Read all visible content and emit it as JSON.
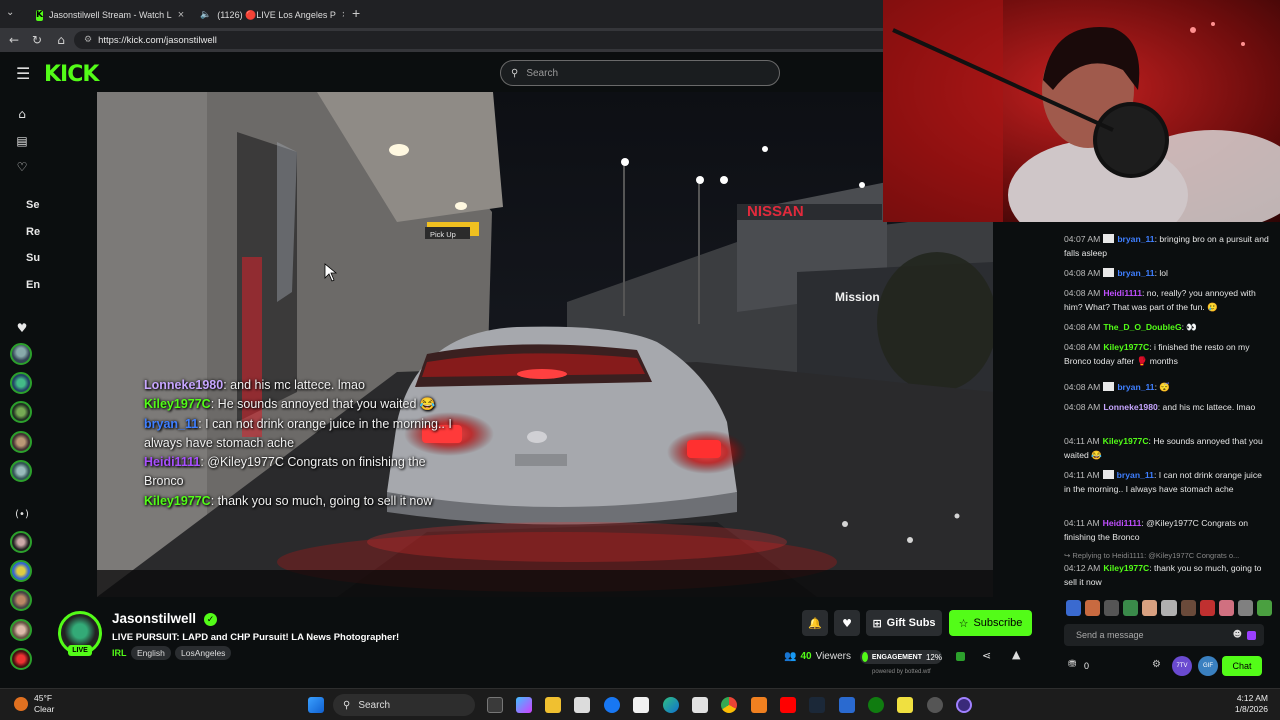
{
  "browser": {
    "tabs": [
      {
        "title": "Jasonstilwell Stream - Watch L",
        "active": true
      },
      {
        "title": "(1126) 🔴LIVE Los Angeles P",
        "active": false
      }
    ],
    "url": "https://kick.com/jasonstilwell"
  },
  "kick": {
    "logo": "KICK",
    "search_placeholder": "Search"
  },
  "sidebar": {
    "items": [
      {
        "icon": "home-icon",
        "glyph": "⌂"
      },
      {
        "icon": "browse-icon",
        "glyph": "▤"
      },
      {
        "icon": "following-heart-icon",
        "glyph": "♡"
      }
    ],
    "truncated_labels": [
      "Se",
      "Re",
      "Su",
      "En"
    ]
  },
  "video_chat_overlay": [
    {
      "name": "Lonneke1980",
      "color": "#c7a6ff",
      "text": ": and his mc lattece. lmao"
    },
    {
      "name": "Kiley1977C",
      "color": "#53fc18",
      "text": ": He sounds annoyed that you waited 😂"
    },
    {
      "name": "bryan_11",
      "color": "#3f7fff",
      "text": ": I can not drink orange juice in the morning.. I always have stomach ache"
    },
    {
      "name": "Heidi1111",
      "color": "#a84fff",
      "text": ": @Kiley1977C Congrats on finishing the Bronco"
    },
    {
      "name": "Kiley1977C",
      "color": "#53fc18",
      "text": ": thank you so much, going to sell it now"
    }
  ],
  "video_scene": {
    "sign_pickup": "Pick Up",
    "sign_mission": "Mission",
    "sign_nissan": "NISSAN"
  },
  "chat": {
    "messages": [
      {
        "time": "04:07 AM",
        "badge": true,
        "name": "bryan_11",
        "color": "#3f7fff",
        "text": ": bringing bro on a pursuit and falls asleep"
      },
      {
        "time": "04:08 AM",
        "badge": true,
        "name": "bryan_11",
        "color": "#3f7fff",
        "text": ": lol"
      },
      {
        "time": "04:08 AM",
        "badge": false,
        "name": "Heidi1111",
        "color": "#c04fff",
        "text": ": no, really? you annoyed with him? What? That was part of the fun. 🥲"
      },
      {
        "time": "04:08 AM",
        "badge": false,
        "name": "The_D_O_DoubleG",
        "color": "#53fc18",
        "text": ": 👀"
      },
      {
        "time": "04:08 AM",
        "badge": false,
        "name": "Kiley1977C",
        "color": "#53fc18",
        "text": ": i finished the resto on my Bronco today after 🥊 months"
      },
      {
        "time": "04:08 AM",
        "badge": true,
        "name": "bryan_11",
        "color": "#3f7fff",
        "text": ": 😴"
      },
      {
        "time": "04:08 AM",
        "badge": false,
        "name": "Lonneke1980",
        "color": "#c7a6ff",
        "text": ": and his mc lattece. lmao"
      },
      {
        "time": "04:11 AM",
        "badge": false,
        "name": "Kiley1977C",
        "color": "#53fc18",
        "text": ": He sounds annoyed that you waited 😂"
      },
      {
        "time": "04:11 AM",
        "badge": true,
        "name": "bryan_11",
        "color": "#3f7fff",
        "text": ": I can not drink orange juice in the morning.. I always have stomach ache"
      },
      {
        "time": "04:11 AM",
        "badge": false,
        "name": "Heidi1111",
        "color": "#c04fff",
        "text": ": @Kiley1977C Congrats on finishing the Bronco"
      }
    ],
    "reply_context": "↪ Replying to Heidi1111: @Kiley1977C Congrats o...",
    "last_message": {
      "time": "04:12 AM",
      "name": "Kiley1977C",
      "color": "#53fc18",
      "text": ": thank you so much, going to sell it now"
    },
    "input_placeholder": "Send a message",
    "points": "0",
    "chat_button": "Chat",
    "badge_7tv": "7TV",
    "badge_gif": "GIF"
  },
  "channel": {
    "name": "Jasonstilwell",
    "live_label": "LIVE",
    "title": "LIVE PURSUIT: LAPD and CHP Pursuit! LA News Photographer!",
    "category": "IRL",
    "tags": [
      "English",
      "LosAngeles"
    ],
    "gift_subs": "Gift Subs",
    "subscribe": "Subscribe",
    "viewers_count": "40",
    "viewers_label": "Viewers",
    "engagement_label": "ENGAGEMENT",
    "engagement_value": "12%",
    "powered_by": "powered by botted.wtf"
  },
  "taskbar": {
    "temperature": "45°F",
    "weather": "Clear",
    "search": "Search",
    "time": "4:12 AM",
    "date": "1/8/2026"
  }
}
